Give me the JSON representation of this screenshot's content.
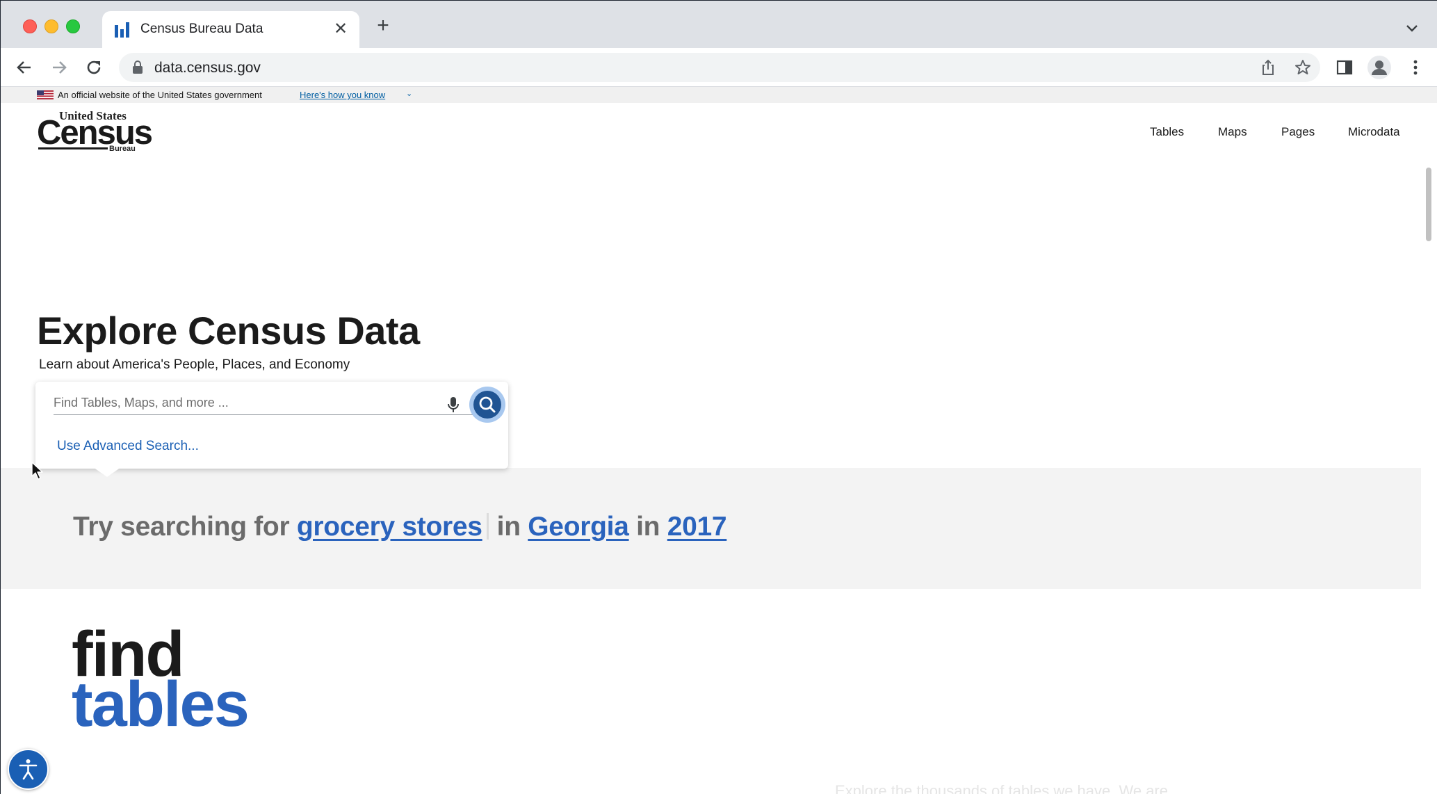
{
  "browser": {
    "tab_title": "Census Bureau Data",
    "new_tab_symbol": "+",
    "close_tab_symbol": "✕",
    "url": "data.census.gov"
  },
  "gov_banner": {
    "text": "An official website of the United States government",
    "link": "Here's how you know",
    "chevron": "⌄"
  },
  "logo": {
    "top": "United States",
    "main": "Census",
    "bottom": "Bureau"
  },
  "nav": {
    "items": [
      "Tables",
      "Maps",
      "Pages",
      "Microdata"
    ]
  },
  "hero": {
    "title": "Explore Census Data",
    "subtitle": "Learn about America's People, Places, and Economy"
  },
  "search": {
    "placeholder": "Find Tables, Maps, and more ...",
    "advanced_link": "Use Advanced Search..."
  },
  "try_searching": {
    "prefix": "Try searching for",
    "term1": "grocery stores",
    "in1": "in",
    "term2": "Georgia",
    "in2": "in",
    "term3": "2017"
  },
  "section": {
    "line1": "find",
    "line2": "tables"
  },
  "faded_intro": "Explore the thousands of tables we have. We are",
  "colors": {
    "accent_blue": "#2a63bd",
    "search_button": "#205493",
    "band_gray": "#f3f3f3"
  }
}
